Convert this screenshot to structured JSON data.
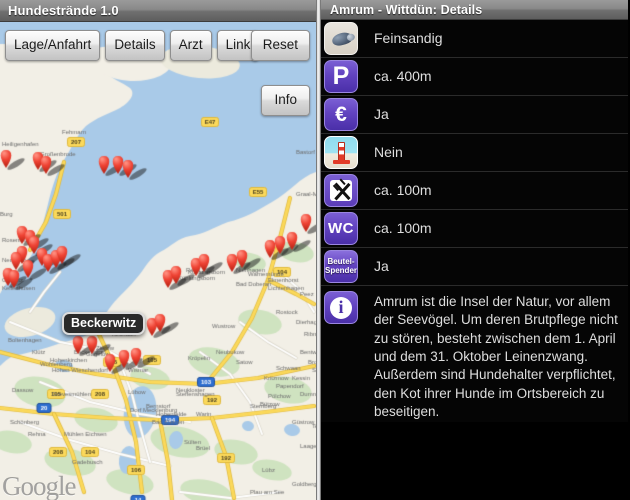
{
  "left": {
    "title": "Hundestrände 1.0",
    "buttons": [
      {
        "label": "Lage/Anfahrt",
        "name": "lage-anfahrt-button"
      },
      {
        "label": "Details",
        "name": "details-button"
      },
      {
        "label": "Arzt",
        "name": "arzt-button"
      },
      {
        "label": "Link",
        "name": "link-button"
      }
    ],
    "reset_label": "Reset",
    "info_label": "Info",
    "map": {
      "tooltip": "Beckerwitz",
      "attribution": "Google",
      "marker_count": 29
    }
  },
  "right": {
    "title": "Amrum - Wittdün: Details",
    "rows": [
      {
        "icon": "sand-icon",
        "value": "Feinsandig"
      },
      {
        "icon": "parking-icon",
        "value": "ca. 400m"
      },
      {
        "icon": "euro-fee-icon",
        "value": "Ja"
      },
      {
        "icon": "beach-lifeguard-icon",
        "value": "Nein"
      },
      {
        "icon": "restaurant-icon",
        "value": "ca. 100m"
      },
      {
        "icon": "wc-icon",
        "value": "ca. 100m"
      },
      {
        "icon": "beutel-spender-icon",
        "value": "Ja"
      }
    ],
    "icon_labels": {
      "parking": "P",
      "euro": "€",
      "wc": "WC",
      "beutel_line1": "Beutel-",
      "beutel_line2": "Spender",
      "info": "i"
    },
    "info_text": "Amrum ist die Insel der Natur, vor allem der Seevögel. Um deren Brutpflege nicht zu stören, besteht zwischen dem 1. April und dem 31. Oktober Leinenzwang. Außerdem sind Hundehalter verpflichtet, den Kot ihrer Hunde im Ortsbereich zu beseitigen."
  },
  "colors": {
    "accent_purple": "#5b3cb8",
    "marker_red": "#ef4435",
    "panel_black": "#050505",
    "titlebar_gray": "#898989"
  }
}
